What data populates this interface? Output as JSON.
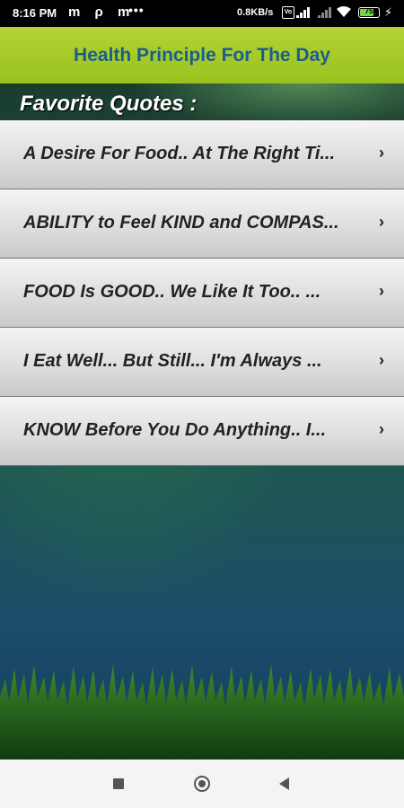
{
  "status_bar": {
    "time": "8:16 PM",
    "notification_icons": "m ρ m",
    "more": "•••",
    "net_speed": "0.8KB/s",
    "volte": "Vo",
    "battery_level": "75",
    "battery_fraction": 0.75
  },
  "header": {
    "title": "Health Principle For The Day"
  },
  "section": {
    "label": "Favorite Quotes :"
  },
  "quotes": [
    {
      "text": "A Desire For Food.. At The Right Ti..."
    },
    {
      "text": "ABILITY to Feel KIND and COMPAS..."
    },
    {
      "text": "FOOD Is GOOD..      We Like It Too..  ..."
    },
    {
      "text": "I Eat Well... But Still...     I'm Always ..."
    },
    {
      "text": "KNOW Before You Do Anything..     I..."
    }
  ],
  "chevron": "›",
  "colors": {
    "header_bg": "#a8cb2a",
    "header_text": "#1b5d8c",
    "list_bg": "#e0e0e0"
  },
  "icons": {
    "nav_recent": "square",
    "nav_home": "circle",
    "nav_back": "triangle-left"
  }
}
